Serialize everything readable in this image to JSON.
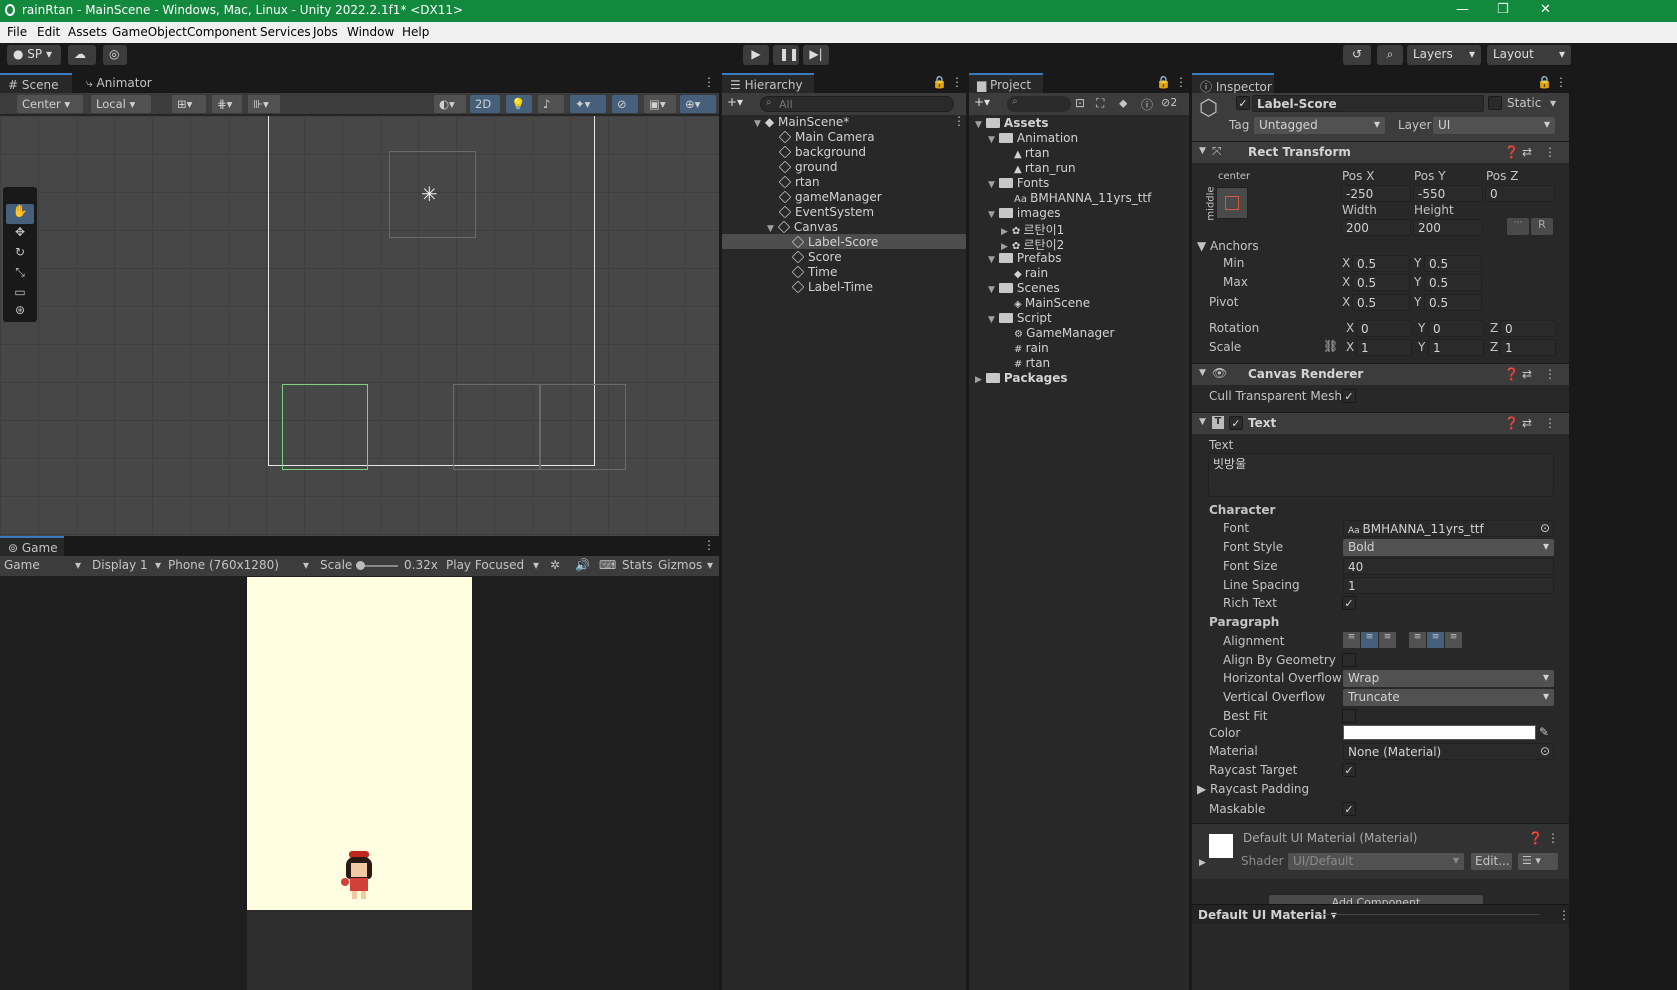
{
  "window": {
    "title": "rainRtan - MainScene - Windows, Mac, Linux - Unity 2022.2.1f1* <DX11>",
    "minimize": "—",
    "maximize": "❐",
    "close": "✕"
  },
  "menu": [
    "File",
    "Edit",
    "Assets",
    "GameObject",
    "Component",
    "Services",
    "Jobs",
    "Window",
    "Help"
  ],
  "toolbar": {
    "account": "SP",
    "layers": "Layers",
    "layout": "Layout"
  },
  "scene": {
    "tabs": [
      "Scene",
      "Animator"
    ],
    "pivot": "Center",
    "space": "Local",
    "mode2d": "2D"
  },
  "game": {
    "tab": "Game",
    "view": "Game",
    "display": "Display 1",
    "resolution": "Phone (760x1280)",
    "scale_label": "Scale",
    "scale_value": "0.32x",
    "play_mode": "Play Focused",
    "stats": "Stats",
    "gizmos": "Gizmos",
    "bg_color": "#fffee0"
  },
  "hierarchy": {
    "tab": "Hierarchy",
    "search_placeholder": "All",
    "scene": "MainScene*",
    "items": [
      "Main Camera",
      "background",
      "ground",
      "rtan",
      "gameManager",
      "EventSystem",
      "Canvas"
    ],
    "canvas_children": [
      "Label-Score",
      "Score",
      "Time",
      "Label-Time"
    ],
    "selected": "Label-Score"
  },
  "project": {
    "tab": "Project",
    "count": "2",
    "tree": [
      {
        "label": "Assets",
        "depth": 0,
        "kind": "folder"
      },
      {
        "label": "Animation",
        "depth": 1,
        "kind": "folder"
      },
      {
        "label": "rtan",
        "depth": 2,
        "kind": "anim"
      },
      {
        "label": "rtan_run",
        "depth": 2,
        "kind": "anim"
      },
      {
        "label": "Fonts",
        "depth": 1,
        "kind": "folder"
      },
      {
        "label": "BMHANNA_11yrs_ttf",
        "depth": 2,
        "kind": "font"
      },
      {
        "label": "images",
        "depth": 1,
        "kind": "folder"
      },
      {
        "label": "르탄이1",
        "depth": 2,
        "kind": "image"
      },
      {
        "label": "르탄이2",
        "depth": 2,
        "kind": "image"
      },
      {
        "label": "Prefabs",
        "depth": 1,
        "kind": "folder"
      },
      {
        "label": "rain",
        "depth": 2,
        "kind": "prefab"
      },
      {
        "label": "Scenes",
        "depth": 1,
        "kind": "folder"
      },
      {
        "label": "MainScene",
        "depth": 2,
        "kind": "scene"
      },
      {
        "label": "Script",
        "depth": 1,
        "kind": "folder"
      },
      {
        "label": "GameManager",
        "depth": 2,
        "kind": "gear"
      },
      {
        "label": "rain",
        "depth": 2,
        "kind": "script"
      },
      {
        "label": "rtan",
        "depth": 2,
        "kind": "script"
      },
      {
        "label": "Packages",
        "depth": 0,
        "kind": "folder"
      }
    ]
  },
  "inspector": {
    "tab": "Inspector",
    "object_name": "Label-Score",
    "static_label": "Static",
    "tag_label": "Tag",
    "tag_value": "Untagged",
    "layer_label": "Layer",
    "layer_value": "UI",
    "rect": {
      "title": "Rect Transform",
      "anchor_h": "center",
      "anchor_v": "middle",
      "posx_label": "Pos X",
      "posx": "-250",
      "posy_label": "Pos Y",
      "posy": "-550",
      "posz_label": "Pos Z",
      "posz": "0",
      "width_label": "Width",
      "width": "200",
      "height_label": "Height",
      "height": "200",
      "raw_btn": "R",
      "anchors": "Anchors",
      "min": "Min",
      "min_x": "0.5",
      "min_y": "0.5",
      "max": "Max",
      "max_x": "0.5",
      "max_y": "0.5",
      "pivot": "Pivot",
      "pivot_x": "0.5",
      "pivot_y": "0.5",
      "rotation": "Rotation",
      "rot_x": "0",
      "rot_y": "0",
      "rot_z": "0",
      "scale": "Scale",
      "scale_x": "1",
      "scale_y": "1",
      "scale_z": "1",
      "x": "X",
      "y": "Y",
      "z": "Z"
    },
    "canvas_renderer": {
      "title": "Canvas Renderer",
      "cull": "Cull Transparent Mesh"
    },
    "text": {
      "title": "Text",
      "text_label": "Text",
      "text_value": "빗방울",
      "character": "Character",
      "font_label": "Font",
      "font_value": "BMHANNA_11yrs_ttf",
      "style_label": "Font Style",
      "style_value": "Bold",
      "size_label": "Font Size",
      "size_value": "40",
      "spacing_label": "Line Spacing",
      "spacing_value": "1",
      "rich_label": "Rich Text",
      "paragraph": "Paragraph",
      "align_label": "Alignment",
      "geom_label": "Align By Geometry",
      "hover_label": "Horizontal Overflow",
      "hover_value": "Wrap",
      "vover_label": "Vertical Overflow",
      "vover_value": "Truncate",
      "best_label": "Best Fit",
      "color_label": "Color",
      "color_value": "#ffffff",
      "material_label": "Material",
      "material_value": "None (Material)",
      "raycast_label": "Raycast Target",
      "padding_label": "Raycast Padding",
      "maskable_label": "Maskable"
    },
    "material": {
      "name": "Default UI Material (Material)",
      "shader_label": "Shader",
      "shader_value": "UI/Default",
      "edit": "Edit...",
      "add_component": "Add Component"
    },
    "footer": "Default UI Material"
  }
}
